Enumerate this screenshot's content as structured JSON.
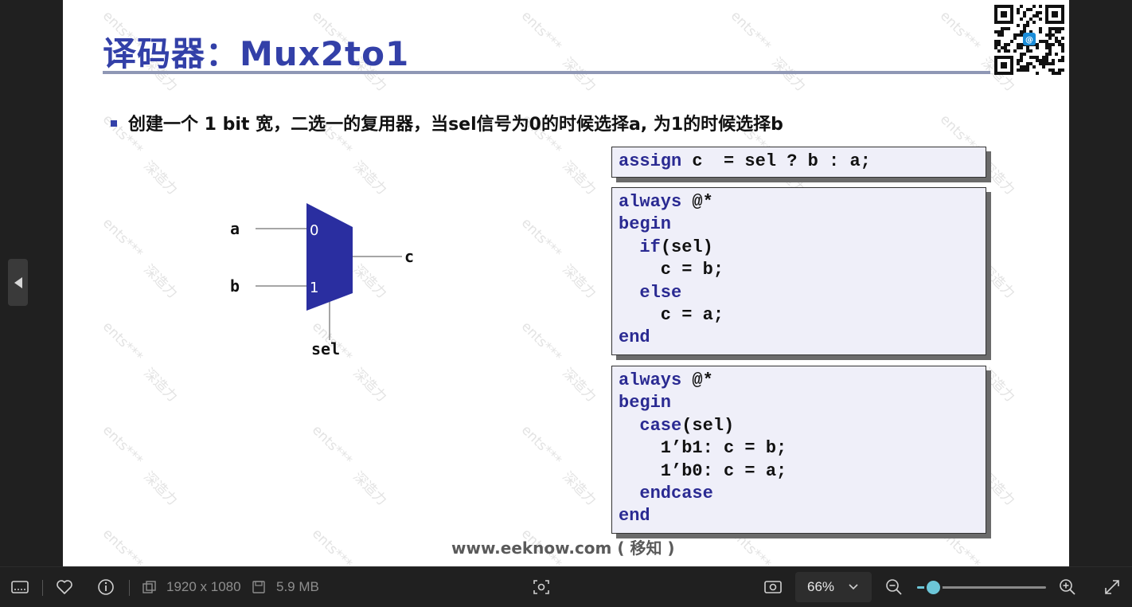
{
  "slide": {
    "title": "译码器：Mux2to1",
    "bullet": "创建一个 1 bit 宽，二选一的复用器，当sel信号为0的时候选择a, 为1的时候选择b",
    "website": "www.eeknow.com ( 移知 )",
    "watermark_a": "ents***",
    "watermark_b": "深造力"
  },
  "diagram": {
    "input_a": "a",
    "input_b": "b",
    "output_c": "c",
    "select": "sel",
    "port0": "0",
    "port1": "1",
    "fill_color": "#2a2ea0"
  },
  "code": {
    "assign": [
      {
        "kw": "assign",
        "rest": " c  = sel ? b : a;"
      }
    ],
    "always_if": [
      {
        "kw": "always",
        "rest": " @*"
      },
      {
        "kw": "begin",
        "rest": ""
      },
      {
        "kw": "  if",
        "rest": "(sel)"
      },
      {
        "kw": "",
        "rest": "    c = b;"
      },
      {
        "kw": "  else",
        "rest": ""
      },
      {
        "kw": "",
        "rest": "    c = a;"
      },
      {
        "kw": "end",
        "rest": ""
      }
    ],
    "always_case": [
      {
        "kw": "always",
        "rest": " @*"
      },
      {
        "kw": "begin",
        "rest": ""
      },
      {
        "kw": "  case",
        "rest": "(sel)"
      },
      {
        "kw": "",
        "rest": "    1’b1: c = b;"
      },
      {
        "kw": "",
        "rest": "    1’b0: c = a;"
      },
      {
        "kw": "  endcase",
        "rest": ""
      },
      {
        "kw": "end",
        "rest": ""
      }
    ]
  },
  "toolbar": {
    "resolution": "1920 x 1080",
    "file_size": "5.9 MB",
    "zoom": "66%",
    "zoom_fraction": 0.12,
    "accent": "#6cc6d8"
  }
}
